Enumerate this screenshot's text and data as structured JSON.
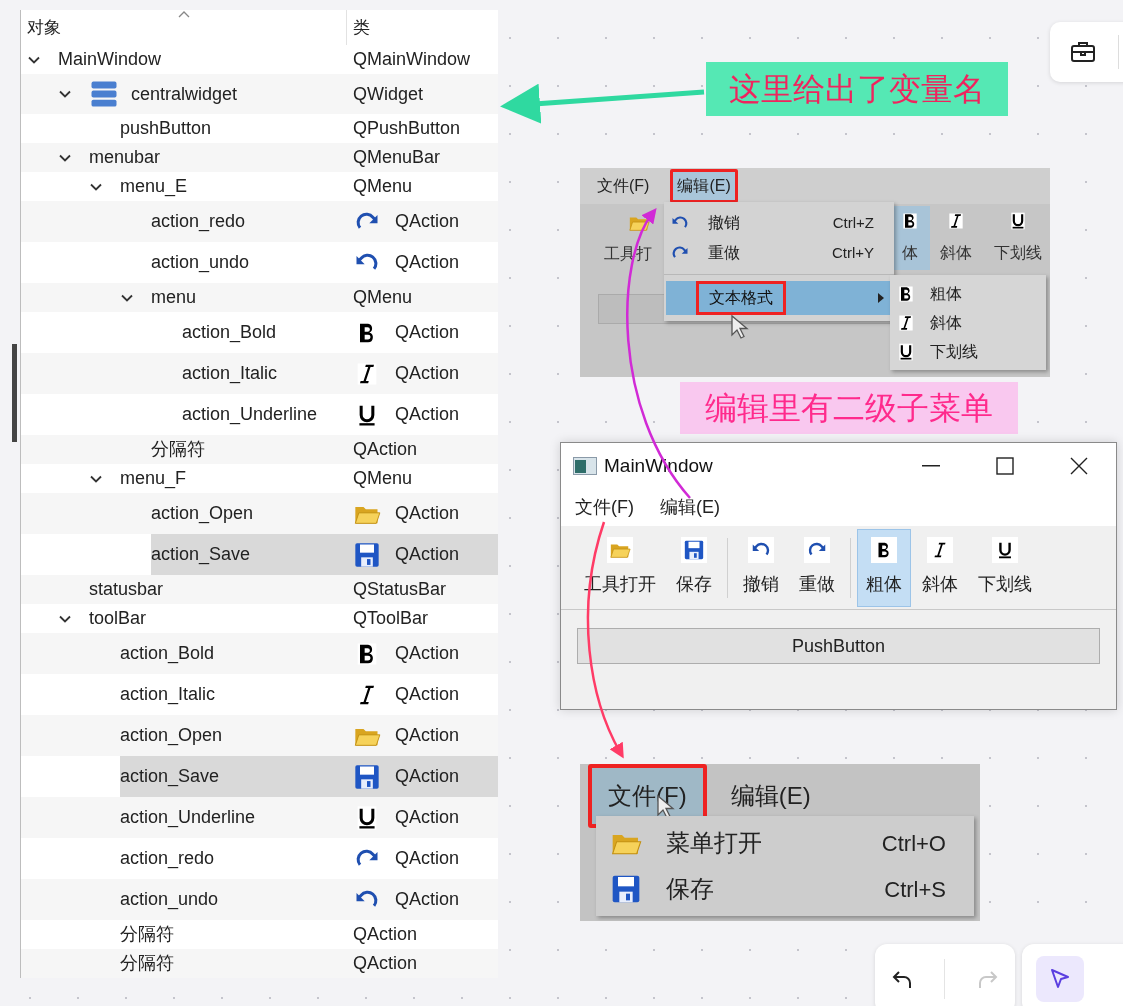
{
  "object_inspector": {
    "columns": [
      "对象",
      "类"
    ],
    "tree": [
      {
        "name": "MainWindow",
        "class": "QMainWindow",
        "expanded": true,
        "selected": false,
        "children": [
          {
            "name": "centralwidget",
            "class": "QWidget",
            "kind": "widget",
            "expanded": true,
            "selected": false,
            "children": [
              {
                "name": "pushButton",
                "class": "QPushButton",
                "selected": false
              }
            ]
          },
          {
            "name": "menubar",
            "class": "QMenuBar",
            "expanded": true,
            "selected": false,
            "children": [
              {
                "name": "menu_E",
                "class": "QMenu",
                "expanded": true,
                "selected": false,
                "children": [
                  {
                    "name": "action_redo",
                    "class": "QAction",
                    "kind": "redo",
                    "selected": false
                  },
                  {
                    "name": "action_undo",
                    "class": "QAction",
                    "kind": "undo",
                    "selected": false
                  },
                  {
                    "name": "menu",
                    "class": "QMenu",
                    "expanded": true,
                    "selected": false,
                    "children": [
                      {
                        "name": "action_Bold",
                        "class": "QAction",
                        "kind": "bold",
                        "selected": false
                      },
                      {
                        "name": "action_Italic",
                        "class": "QAction",
                        "kind": "italic",
                        "selected": false
                      },
                      {
                        "name": "action_Underline",
                        "class": "QAction",
                        "kind": "underline",
                        "selected": false
                      }
                    ]
                  },
                  {
                    "name": "分隔符",
                    "class": "QAction",
                    "selected": false
                  }
                ]
              },
              {
                "name": "menu_F",
                "class": "QMenu",
                "expanded": true,
                "selected": false,
                "children": [
                  {
                    "name": "action_Open",
                    "class": "QAction",
                    "kind": "open",
                    "selected": false
                  },
                  {
                    "name": "action_Save",
                    "class": "QAction",
                    "kind": "save",
                    "selected": true
                  }
                ]
              }
            ]
          },
          {
            "name": "statusbar",
            "class": "QStatusBar",
            "selected": false
          },
          {
            "name": "toolBar",
            "class": "QToolBar",
            "expanded": true,
            "selected": false,
            "children": [
              {
                "name": "action_Bold",
                "class": "QAction",
                "kind": "bold",
                "selected": false
              },
              {
                "name": "action_Italic",
                "class": "QAction",
                "kind": "italic",
                "selected": false
              },
              {
                "name": "action_Open",
                "class": "QAction",
                "kind": "open",
                "selected": false
              },
              {
                "name": "action_Save",
                "class": "QAction",
                "kind": "save",
                "selected": true
              },
              {
                "name": "action_Underline",
                "class": "QAction",
                "kind": "underline",
                "selected": false
              },
              {
                "name": "action_redo",
                "class": "QAction",
                "kind": "redo",
                "selected": false
              },
              {
                "name": "action_undo",
                "class": "QAction",
                "kind": "undo",
                "selected": false
              },
              {
                "name": "分隔符",
                "class": "QAction",
                "selected": false
              },
              {
                "name": "分隔符",
                "class": "QAction",
                "selected": false
              }
            ]
          }
        ]
      }
    ]
  },
  "canvas": {
    "notes": [
      {
        "text": "这里给出了变量名",
        "color": "#55e8b4"
      },
      {
        "text": "编辑里有二级子菜单",
        "color": "#f9c8ef"
      }
    ],
    "edit_menu_photo": {
      "menus": [
        {
          "label": "文件(F)",
          "outlined": false
        },
        {
          "label": "编辑(E)",
          "outlined": true
        }
      ],
      "toolbar_behind": [
        "工具打",
        "体",
        "斜体",
        "下划线"
      ],
      "items": [
        {
          "kind": "undo",
          "label": "撤销",
          "shortcut": "Ctrl+Z"
        },
        {
          "kind": "redo",
          "label": "重做",
          "shortcut": "Ctrl+Y"
        },
        {
          "kind": "submenu",
          "label": "文本格式",
          "selected": true,
          "outlined": true
        }
      ],
      "submenu": [
        {
          "kind": "bold",
          "label": "粗体"
        },
        {
          "kind": "italic",
          "label": "斜体"
        },
        {
          "kind": "underline",
          "label": "下划线"
        }
      ]
    },
    "designer_window": {
      "title": "MainWindow",
      "menus": [
        "文件(F)",
        "编辑(E)"
      ],
      "toolbar": [
        {
          "kind": "open",
          "label": "工具打开",
          "selected": false
        },
        {
          "kind": "save",
          "label": "保存",
          "selected": false
        },
        {
          "kind": "separator"
        },
        {
          "kind": "undo",
          "label": "撤销",
          "selected": false
        },
        {
          "kind": "redo",
          "label": "重做",
          "selected": false
        },
        {
          "kind": "separator"
        },
        {
          "kind": "bold",
          "label": "粗体",
          "selected": true
        },
        {
          "kind": "italic",
          "label": "斜体",
          "selected": false
        },
        {
          "kind": "underline",
          "label": "下划线",
          "selected": false
        }
      ],
      "button": "PushButton"
    },
    "file_menu_photo": {
      "menus": [
        {
          "label": "文件(F)",
          "outlined": true
        },
        {
          "label": "编辑(E)",
          "outlined": false
        }
      ],
      "items": [
        {
          "kind": "open",
          "label": "菜单打开",
          "shortcut": "Ctrl+O"
        },
        {
          "kind": "save",
          "label": "保存",
          "shortcut": "Ctrl+S"
        }
      ]
    }
  }
}
